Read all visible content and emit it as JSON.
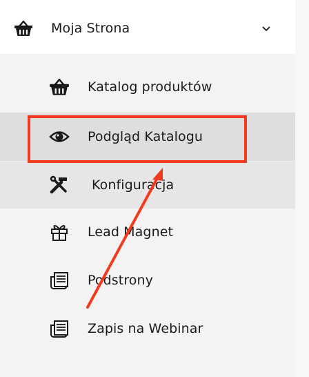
{
  "menu": {
    "title": "Moja Strona",
    "title_icon": "basket-icon",
    "expanded": true,
    "items": [
      {
        "label": "Katalog produktów",
        "icon": "basket-icon"
      },
      {
        "label": "Podgląd Katalogu",
        "icon": "eye-icon"
      },
      {
        "label": "Konfiguracja",
        "icon": "tools-icon"
      },
      {
        "label": "Lead Magnet",
        "icon": "gift-icon"
      },
      {
        "label": "Podstrony",
        "icon": "pages-icon"
      },
      {
        "label": "Zapis na Webinar",
        "icon": "pages-icon"
      }
    ]
  },
  "annotation": {
    "target_item": "Podgląd Katalogu",
    "color": "#f23a1e"
  }
}
